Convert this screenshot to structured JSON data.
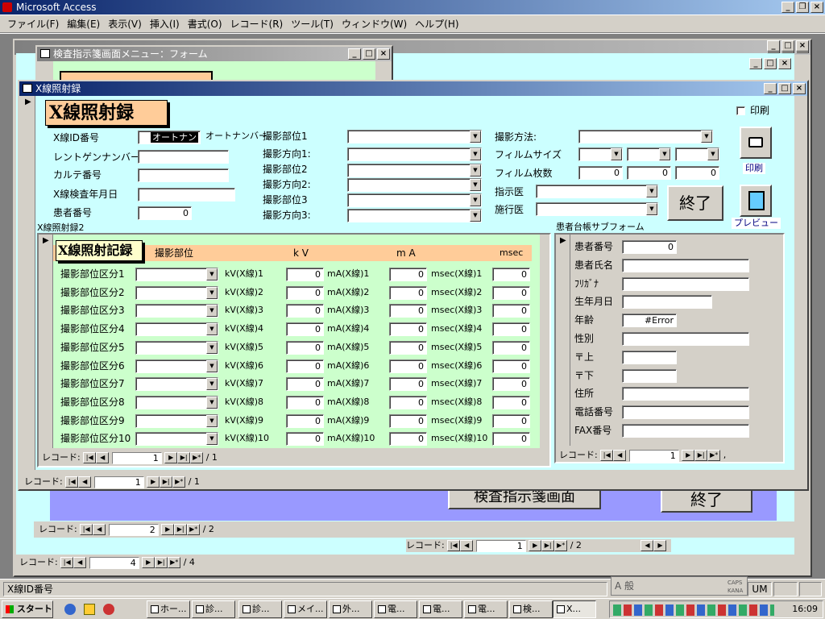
{
  "app": {
    "title": "Microsoft Access"
  },
  "menu": [
    "ファイル(F)",
    "編集(E)",
    "表示(V)",
    "挿入(I)",
    "書式(O)",
    "レコード(R)",
    "ツール(T)",
    "ウィンドウ(W)",
    "ヘルプ(H)"
  ],
  "back_window": {
    "title": "検査指示箋画面メニュー：フォーム",
    "button_main": "検査指示箋画面",
    "button_exit": "終了",
    "nav_label": "レコード:",
    "nav_a_value": "2",
    "nav_a_total": "/ 2",
    "nav_b_value": "1",
    "nav_b_total": "/ 2",
    "nav_c_value": "4",
    "nav_c_total": "/ 4"
  },
  "form": {
    "title": "X線照射録",
    "heading": "X線照射録",
    "print_checkbox_label": "印刷",
    "left_fields": [
      {
        "label": "X線ID番号",
        "value": "オートナン"
      },
      {
        "label": "レントゲンナンバー",
        "value": ""
      },
      {
        "label": "カルテ番号",
        "value": ""
      },
      {
        "label": "X線検査年月日",
        "value": ""
      },
      {
        "label": "患者番号",
        "value": "0"
      }
    ],
    "autonumber_hint": "オートナンバー",
    "mid_fields": [
      "撮影部位1",
      "撮影方向1:",
      "撮影部位2",
      "撮影方向2:",
      "撮影部位3",
      "撮影方向3:"
    ],
    "right_fields": {
      "method": "撮影方法:",
      "film_size": "フィルムサイズ",
      "film_count": "フィルム枚数",
      "film_count_values": [
        "0",
        "0",
        "0"
      ],
      "ordering_doctor": "指示医",
      "performing_doctor": "施行医"
    },
    "exit_button": "終了",
    "print_button_label": "印刷",
    "preview_button_label": "プレビュー",
    "subform_label": "X線照射録2",
    "nav_label": "レコード:",
    "nav_value": "1",
    "nav_total": "/ 1"
  },
  "subform": {
    "heading": "X線照射記録",
    "col_headers": {
      "part": "撮影部位",
      "kv": "k V",
      "ma": "m A",
      "msec": "msec"
    },
    "rows": [
      {
        "part": "撮影部位区分1",
        "kv": "kV(X線)1",
        "kv_val": "0",
        "ma": "mA(X線)1",
        "ma_val": "0",
        "ms": "msec(X線)1",
        "ms_val": "0"
      },
      {
        "part": "撮影部位区分2",
        "kv": "kV(X線)2",
        "kv_val": "0",
        "ma": "mA(X線)2",
        "ma_val": "0",
        "ms": "msec(X線)2",
        "ms_val": "0"
      },
      {
        "part": "撮影部位区分3",
        "kv": "kV(X線)3",
        "kv_val": "0",
        "ma": "mA(X線)3",
        "ma_val": "0",
        "ms": "msec(X線)3",
        "ms_val": "0"
      },
      {
        "part": "撮影部位区分4",
        "kv": "kV(X線)4",
        "kv_val": "0",
        "ma": "mA(X線)4",
        "ma_val": "0",
        "ms": "msec(X線)4",
        "ms_val": "0"
      },
      {
        "part": "撮影部位区分5",
        "kv": "kV(X線)5",
        "kv_val": "0",
        "ma": "mA(X線)5",
        "ma_val": "0",
        "ms": "msec(X線)5",
        "ms_val": "0"
      },
      {
        "part": "撮影部位区分6",
        "kv": "kV(X線)6",
        "kv_val": "0",
        "ma": "mA(X線)6",
        "ma_val": "0",
        "ms": "msec(X線)6",
        "ms_val": "0"
      },
      {
        "part": "撮影部位区分7",
        "kv": "kV(X線)7",
        "kv_val": "0",
        "ma": "mA(X線)7",
        "ma_val": "0",
        "ms": "msec(X線)7",
        "ms_val": "0"
      },
      {
        "part": "撮影部位区分8",
        "kv": "kV(X線)8",
        "kv_val": "0",
        "ma": "mA(X線)8",
        "ma_val": "0",
        "ms": "msec(X線)8",
        "ms_val": "0"
      },
      {
        "part": "撮影部位区分9",
        "kv": "kV(X線)9",
        "kv_val": "0",
        "ma": "mA(X線)9",
        "ma_val": "0",
        "ms": "msec(X線)9",
        "ms_val": "0"
      },
      {
        "part": "撮影部位区分10",
        "kv": "kV(X線)10",
        "kv_val": "0",
        "ma": "mA(X線)10",
        "ma_val": "0",
        "ms": "msec(X線)10",
        "ms_val": "0"
      }
    ],
    "nav_label": "レコード:",
    "nav_value": "1",
    "nav_total": "/ 1"
  },
  "patient": {
    "label": "患者台帳サブフォーム",
    "fields": [
      {
        "label": "患者番号",
        "value": "0"
      },
      {
        "label": "患者氏名",
        "value": ""
      },
      {
        "label": "ﾌﾘｶﾞﾅ",
        "value": ""
      },
      {
        "label": "生年月日",
        "value": ""
      },
      {
        "label": "年齢",
        "value": "#Error"
      },
      {
        "label": "性別",
        "value": ""
      },
      {
        "label": "〒上",
        "value": ""
      },
      {
        "label": "〒下",
        "value": ""
      },
      {
        "label": "住所",
        "value": ""
      },
      {
        "label": "電話番号",
        "value": ""
      },
      {
        "label": "FAX番号",
        "value": ""
      }
    ],
    "nav_label": "レコード:",
    "nav_value": "1",
    "nav_total": ","
  },
  "status": {
    "text": "X線ID番号",
    "ime": "A 般",
    "caps": "CAPS",
    "kana": "KANA",
    "num": "UM"
  },
  "taskbar": {
    "start": "スタート",
    "tasks": [
      "ホー...",
      "診...",
      "診...",
      "メイ...",
      "外...",
      "電...",
      "電...",
      "電...",
      "検...",
      "X..."
    ],
    "clock": "16:09"
  },
  "colors": {
    "form_bg": "#ccffff",
    "header_peach": "#ffcc99",
    "sub_green": "#ccffcc",
    "back_purple": "#9999ff"
  }
}
